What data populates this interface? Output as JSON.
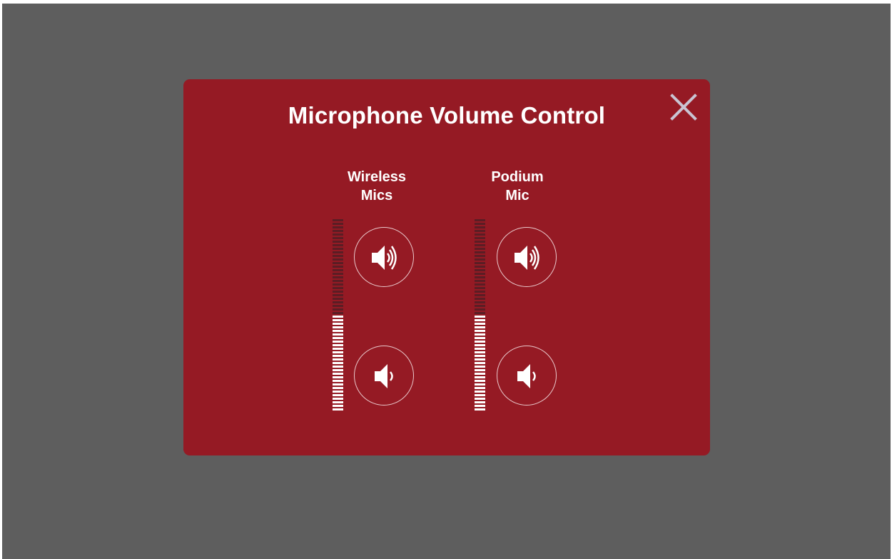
{
  "modal": {
    "title": "Microphone Volume Control",
    "close_icon": "close-x-icon"
  },
  "channels": [
    {
      "id": "wireless",
      "label_line1": "Wireless",
      "label_line2": "Mics",
      "level": 0.5,
      "volume_up_icon": "speaker-volume-up-icon",
      "volume_down_icon": "speaker-volume-down-icon"
    },
    {
      "id": "podium",
      "label_line1": "Podium",
      "label_line2": "Mic",
      "level": 0.5,
      "volume_up_icon": "speaker-volume-up-icon",
      "volume_down_icon": "speaker-volume-down-icon"
    }
  ],
  "colors": {
    "backdrop": "#5e5e5e",
    "modal_bg": "#951a24",
    "meter_on": "#ffffff",
    "meter_off": "#5b1d24",
    "close_icon": "#c9c4d2"
  }
}
